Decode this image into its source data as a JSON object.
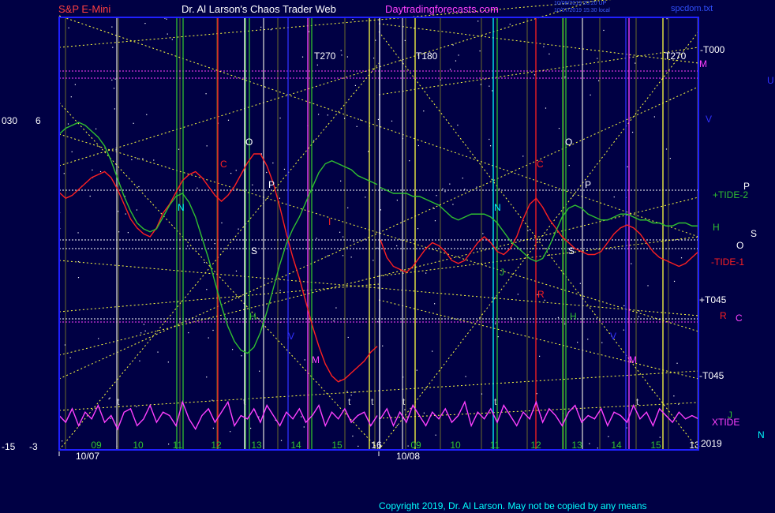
{
  "header": {
    "symbol": "S&P E-Mini",
    "title": "Dr. Al Larson's Chaos Trader Web",
    "site": "Daytradingforecasts.com",
    "stamp1": "10/08/2019 20:20 UP",
    "stamp2": "10/07/2019 15:30 local",
    "file": "spcdom.txt"
  },
  "copyright": "Copyright 2019, Dr. Al Larson. May not be copied by any means",
  "colors": {
    "background": "#000044",
    "frame": "#2020ff",
    "price": "#ff2020",
    "tide": "#30c030",
    "xtide": "#ff40ff",
    "envelope": "#ffff40",
    "dotline": "#ffffff"
  },
  "chart_data": {
    "type": "line",
    "x_ticks": [
      "09",
      "10",
      "11",
      "12",
      "13",
      "14",
      "15",
      "16",
      "09",
      "10",
      "11",
      "12",
      "13",
      "14",
      "15",
      "13"
    ],
    "dates": [
      "10/07",
      "10/08"
    ],
    "year": "2019",
    "left_axis": [
      "030",
      "6",
      "-15",
      "-3"
    ],
    "right_labels": [
      "-T000",
      "M",
      "U",
      "V",
      "+TIDE-2",
      "P",
      "H",
      "O",
      "S",
      "-TIDE-1",
      "+T045",
      "R",
      "C",
      "-T045",
      "XTIDE",
      "J",
      "N"
    ],
    "top_labels": [
      "T270",
      "T180",
      "T270"
    ],
    "event_labels": {
      "day1": [
        "N",
        "C",
        "O",
        "P",
        "S",
        "H",
        "V",
        "M",
        "I",
        "t",
        "t",
        "t",
        "t"
      ],
      "day2": [
        "N",
        "C",
        "O",
        "P",
        "S",
        "H",
        "V",
        "M",
        "J",
        "R",
        "t",
        "t",
        "t"
      ]
    },
    "series": [
      {
        "values_day1": [
          0.67,
          0.65,
          0.66,
          0.68,
          0.7,
          0.72,
          0.73,
          0.74,
          0.72,
          0.68,
          0.63,
          0.58,
          0.55,
          0.53,
          0.52,
          0.55,
          0.6,
          0.63,
          0.67,
          0.71,
          0.73,
          0.74,
          0.72,
          0.69,
          0.66,
          0.64,
          0.66,
          0.69,
          0.73,
          0.77,
          0.8,
          0.8,
          0.76,
          0.7,
          0.62,
          0.53,
          0.45,
          0.38,
          0.3,
          0.22,
          0.15,
          0.09,
          0.05,
          0.03,
          0.04,
          0.06,
          0.08,
          0.1,
          0.13,
          0.15
        ],
        "values_day2": [
          0.51,
          0.45,
          0.42,
          0.41,
          0.4,
          0.42,
          0.45,
          0.48,
          0.5,
          0.49,
          0.47,
          0.44,
          0.43,
          0.44,
          0.47,
          0.5,
          0.52,
          0.5,
          0.47,
          0.46,
          0.48,
          0.52,
          0.58,
          0.63,
          0.65,
          0.62,
          0.58,
          0.55,
          0.52,
          0.5,
          0.48,
          0.47,
          0.46,
          0.46,
          0.47,
          0.5,
          0.53,
          0.55,
          0.56,
          0.55,
          0.53,
          0.5,
          0.47,
          0.45,
          0.44,
          0.43,
          0.42,
          0.43,
          0.45,
          0.47
        ]
      },
      {
        "values_day1": [
          0.8,
          0.82,
          0.83,
          0.84,
          0.83,
          0.81,
          0.79,
          0.76,
          0.71,
          0.65,
          0.59,
          0.54,
          0.5,
          0.48,
          0.47,
          0.48,
          0.52,
          0.56,
          0.59,
          0.6,
          0.57,
          0.52,
          0.45,
          0.38,
          0.3,
          0.22,
          0.15,
          0.1,
          0.07,
          0.06,
          0.08,
          0.13,
          0.2,
          0.28,
          0.36,
          0.43,
          0.48,
          0.52,
          0.57,
          0.62,
          0.67,
          0.7,
          0.71,
          0.7,
          0.69,
          0.68,
          0.66,
          0.65,
          0.64,
          0.63
        ],
        "values_day2": [
          0.62,
          0.61,
          0.6,
          0.6,
          0.6,
          0.59,
          0.59,
          0.58,
          0.57,
          0.56,
          0.54,
          0.52,
          0.51,
          0.52,
          0.53,
          0.53,
          0.53,
          0.52,
          0.5,
          0.47,
          0.44,
          0.42,
          0.4,
          0.38,
          0.37,
          0.38,
          0.42,
          0.47,
          0.52,
          0.55,
          0.56,
          0.55,
          0.53,
          0.52,
          0.51,
          0.51,
          0.52,
          0.53,
          0.53,
          0.52,
          0.51,
          0.51,
          0.5,
          0.5,
          0.49,
          0.49,
          0.5,
          0.5,
          0.49,
          0.49
        ]
      },
      {
        "values_day1": [
          0.5,
          0.3,
          0.7,
          0.2,
          0.6,
          0.4,
          0.8,
          0.3,
          0.5,
          0.1,
          0.6,
          0.7,
          0.2,
          0.4,
          0.8,
          0.3,
          0.6,
          0.5,
          0.2,
          0.9,
          0.4,
          0.1,
          0.5,
          0.7,
          0.3,
          0.6,
          0.9,
          0.2,
          0.5,
          0.4,
          0.7,
          0.3,
          0.8,
          0.5,
          0.2,
          0.6,
          0.4,
          0.7,
          0.3,
          0.5,
          0.8,
          0.2,
          0.6,
          0.4,
          0.7,
          0.3,
          0.5,
          0.6,
          0.2,
          0.5
        ],
        "values_day2": [
          0.4,
          0.7,
          0.2,
          0.6,
          0.3,
          0.8,
          0.5,
          0.2,
          0.6,
          0.4,
          0.7,
          0.3,
          0.5,
          0.9,
          0.2,
          0.6,
          0.4,
          0.7,
          0.3,
          0.8,
          0.5,
          0.2,
          0.6,
          0.4,
          0.9,
          0.3,
          0.7,
          0.5,
          0.2,
          0.6,
          0.8,
          0.3,
          0.5,
          0.4,
          0.7,
          0.2,
          0.6,
          0.5,
          0.3,
          0.8,
          0.4,
          0.6,
          0.2,
          0.7,
          0.5,
          0.3,
          0.6,
          0.4,
          0.5,
          0.4
        ]
      }
    ]
  }
}
